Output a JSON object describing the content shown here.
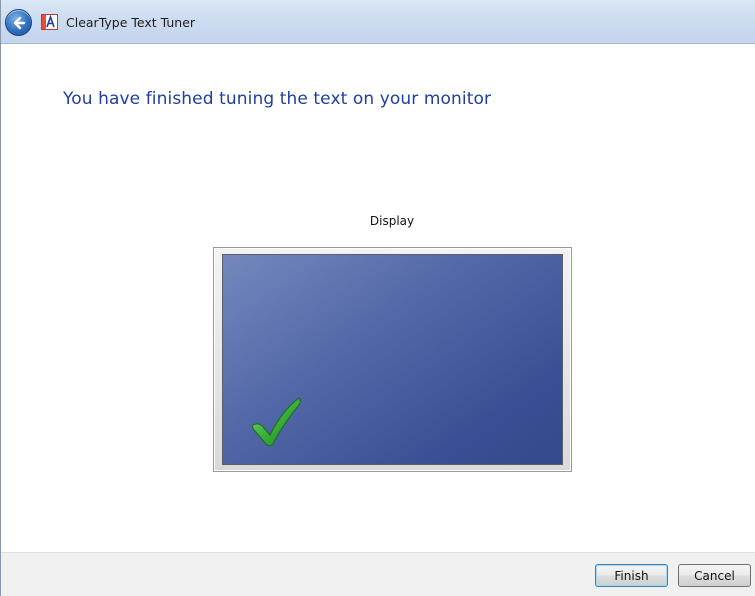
{
  "window": {
    "title": "ClearType Text Tuner"
  },
  "icons": {
    "back": "back-arrow-icon",
    "app": "cleartype-app-icon",
    "check": "checkmark-icon"
  },
  "main": {
    "heading": "You have finished tuning the text on your monitor",
    "display_label": "Display"
  },
  "footer": {
    "finish_label": "Finish",
    "cancel_label": "Cancel"
  },
  "colors": {
    "heading": "#1f3f9e",
    "screen": "#4a5fa0",
    "check": "#3bb13b"
  }
}
